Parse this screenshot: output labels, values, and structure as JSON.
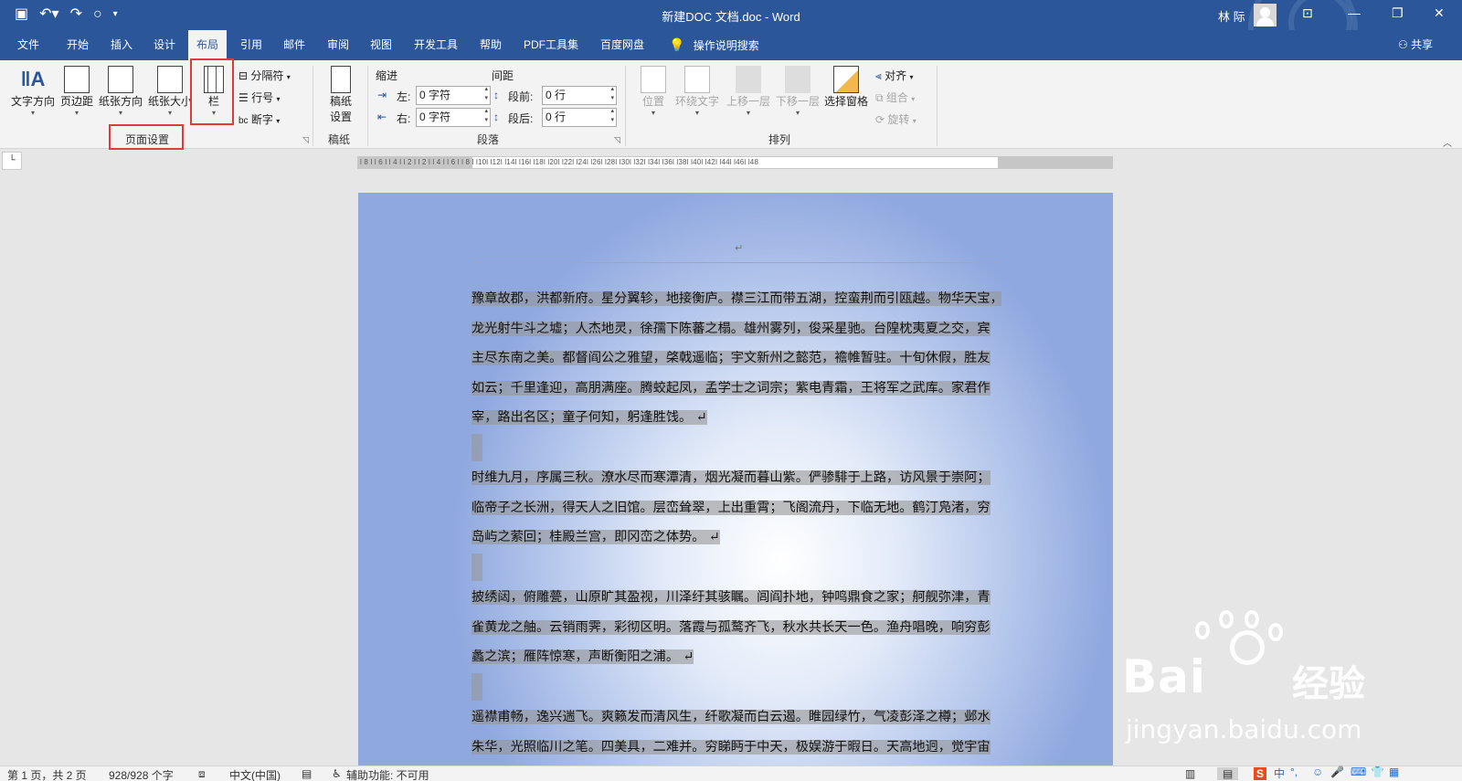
{
  "window": {
    "title": "新建DOC 文档.doc  -  Word",
    "user": "林 际"
  },
  "menu": {
    "tabs": [
      "文件",
      "开始",
      "插入",
      "设计",
      "布局",
      "引用",
      "邮件",
      "审阅",
      "视图",
      "开发工具",
      "帮助",
      "PDF工具集",
      "百度网盘"
    ],
    "active_tab": "布局",
    "tell_me": "操作说明搜索",
    "share": "共享"
  },
  "ribbon": {
    "page_setup": {
      "text_direction": "文字方向",
      "margins": "页边距",
      "orientation": "纸张方向",
      "size": "纸张大小",
      "columns": "栏",
      "breaks": "分隔符",
      "line_numbers": "行号",
      "hyphenation": "断字",
      "label": "页面设置"
    },
    "manuscript": {
      "settings_line1": "稿纸",
      "settings_line2": "设置",
      "label": "稿纸"
    },
    "paragraph": {
      "indent_title": "缩进",
      "spacing_title": "间距",
      "left_label": "左:",
      "left_value": "0 字符",
      "right_label": "右:",
      "right_value": "0 字符",
      "before_label": "段前:",
      "before_value": "0 行",
      "after_label": "段后:",
      "after_value": "0 行",
      "label": "段落"
    },
    "arrange": {
      "position": "位置",
      "wrap_text": "环绕文字",
      "bring_forward": "上移一层",
      "send_backward": "下移一层",
      "selection_pane": "选择窗格",
      "align": "对齐",
      "group": "组合",
      "rotate": "旋转",
      "label": "排列"
    }
  },
  "ruler": {
    "ticks": "l 8 l  l 6 l  l 4 l  l 2 l        l 2 l  l 4 l  l 6 l  l 8 l  l10l  l12l  l14l  l16l  l18l  l20l  l22l  l24l  l26l  l28l  l30l  l32l  l34l  l36l  l38l   l40l  l42l  l44l  l46l  l48"
  },
  "document": {
    "paragraphs": [
      {
        "lines": [
          "豫章故郡，洪都新府。星分翼轸，地接衡庐。襟三江而带五湖，控蛮荆而引瓯越。物华天宝，",
          "龙光射牛斗之墟；人杰地灵，徐孺下陈蕃之榻。雄州雾列，俊采星驰。台隍枕夷夏之交，宾",
          "主尽东南之美。都督阎公之雅望，棨戟遥临；宇文新州之懿范，襜帷暂驻。十旬休假，胜友",
          "如云；千里逢迎，高朋满座。腾蛟起凤，孟学士之词宗；紫电青霜，王将军之武库。家君作",
          "宰，路出名区；童子何知，躬逢胜饯。"
        ]
      },
      {
        "lines": [
          "时维九月，序属三秋。潦水尽而寒潭清，烟光凝而暮山紫。俨骖騑于上路，访风景于崇阿；",
          "临帝子之长洲，得天人之旧馆。层峦耸翠，上出重霄；飞阁流丹，下临无地。鹤汀凫渚，穷",
          "岛屿之萦回；桂殿兰宫，即冈峦之体势。"
        ]
      },
      {
        "lines": [
          "披绣闼，俯雕甍，山原旷其盈视，川泽纡其骇瞩。闾阎扑地，钟鸣鼎食之家；舸舰弥津，青",
          "雀黄龙之舳。云销雨霁，彩彻区明。落霞与孤鹜齐飞，秋水共长天一色。渔舟唱晚，响穷彭",
          "蠡之滨；雁阵惊寒，声断衡阳之浦。"
        ]
      },
      {
        "lines": [
          "遥襟甫畅，逸兴遄飞。爽籁发而清风生，纤歌凝而白云遏。睢园绿竹，气凌彭泽之樽；邺水",
          "朱华，光照临川之笔。四美具，二难并。穷睇眄于中天，极娱游于暇日。天高地迥，觉宇宙"
        ]
      }
    ]
  },
  "status": {
    "page": "第 1 页，共 2 页",
    "words": "928/928 个字",
    "language": "中文(中国)",
    "accessibility": "辅助功能: 不可用"
  },
  "ime": {
    "mode": "中"
  },
  "watermark": {
    "brand_left": "Bai",
    "brand_right": "经验",
    "url": "jingyan.baidu.com"
  },
  "colors": {
    "title_blue": "#2b579a",
    "highlight_red": "#e03a3a"
  }
}
